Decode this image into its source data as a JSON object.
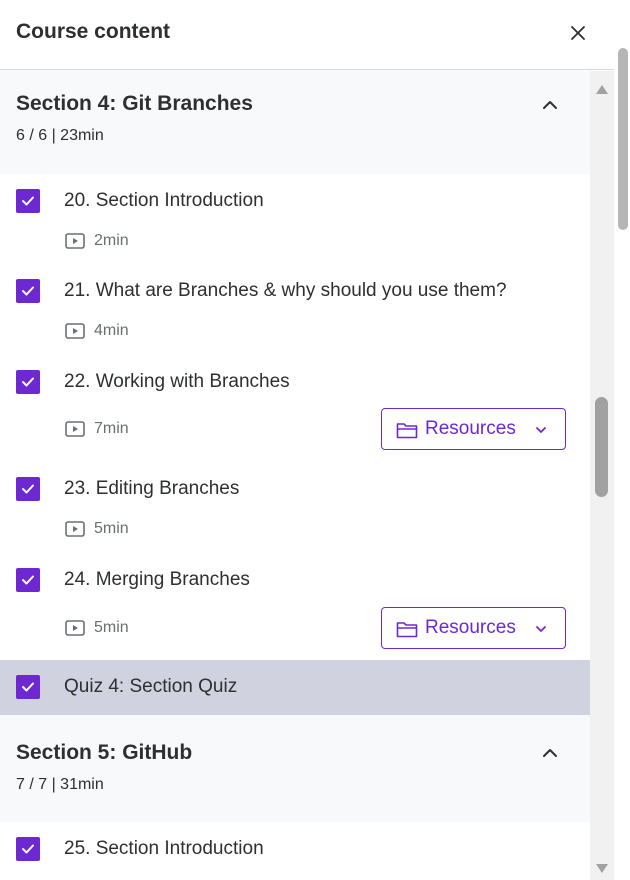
{
  "header": {
    "title": "Course content"
  },
  "sections": [
    {
      "title": "Section 4: Git Branches",
      "meta": "6 / 6 | 23min",
      "items": [
        {
          "title": "20. Section Introduction",
          "duration": "2min"
        },
        {
          "title": "21. What are Branches & why should you use them?",
          "duration": "4min"
        },
        {
          "title": "22. Working with Branches",
          "duration": "7min",
          "resources_label": "Resources"
        },
        {
          "title": "23. Editing Branches",
          "duration": "5min"
        },
        {
          "title": "24. Merging Branches",
          "duration": "5min",
          "resources_label": "Resources"
        },
        {
          "title": "Quiz 4: Section Quiz"
        }
      ]
    },
    {
      "title": "Section 5: GitHub",
      "meta": "7 / 7 | 31min",
      "items": [
        {
          "title": "25. Section Introduction"
        }
      ]
    }
  ],
  "colors": {
    "accent": "#6d28d2",
    "section_bg": "#f7f9fa",
    "active_item_bg": "#d1d2e0",
    "muted_text": "#6a6f73"
  }
}
